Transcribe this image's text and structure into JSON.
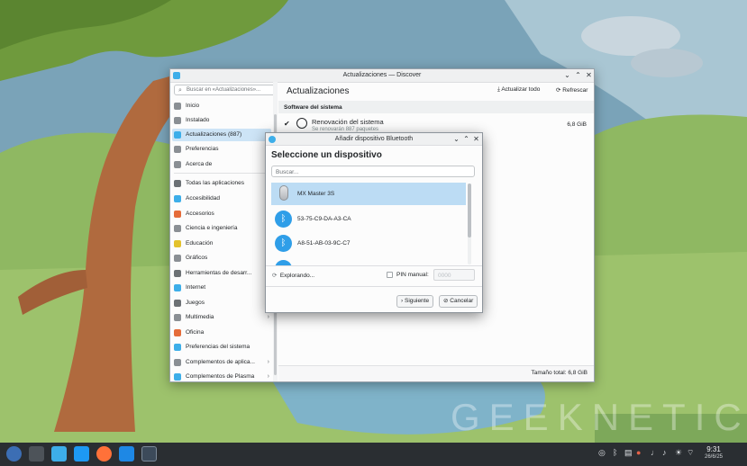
{
  "colors": {
    "accent": "#3daee9",
    "selection": "#cde4f6",
    "sky": "#7aa3b8",
    "grass": "#8fb862",
    "tree": "#b06a3e",
    "taskbar": "#2a2e32"
  },
  "discover": {
    "title": "Actualizaciones — Discover",
    "search_placeholder": "Buscar en «Actualizaciones»...",
    "page_title": "Actualizaciones",
    "update_all": "Actualizar todo",
    "refresh": "Refrescar",
    "nav": [
      {
        "label": "Inicio",
        "icon": "home-icon"
      },
      {
        "label": "Instalado",
        "icon": "installed-icon"
      },
      {
        "label": "Actualizaciones (887)",
        "icon": "updates-icon"
      },
      {
        "label": "Preferencias",
        "icon": "settings-icon"
      },
      {
        "label": "Acerca de",
        "icon": "info-icon"
      },
      {
        "label": "Todas las aplicaciones",
        "icon": "grid-icon"
      },
      {
        "label": "Accesibilidad",
        "icon": "accessibility-icon"
      },
      {
        "label": "Accesorios",
        "icon": "accessories-icon"
      },
      {
        "label": "Ciencia e ingeniería",
        "icon": "science-icon"
      },
      {
        "label": "Educación",
        "icon": "education-icon"
      },
      {
        "label": "Gráficos",
        "icon": "graphics-icon"
      },
      {
        "label": "Herramientas de desarr...",
        "icon": "dev-tools-icon"
      },
      {
        "label": "Internet",
        "icon": "internet-icon"
      },
      {
        "label": "Juegos",
        "icon": "games-icon"
      },
      {
        "label": "Multimedia",
        "icon": "multimedia-icon"
      },
      {
        "label": "Oficina",
        "icon": "office-icon"
      },
      {
        "label": "Preferencias del sistema",
        "icon": "system-settings-icon"
      },
      {
        "label": "Complementos de aplica...",
        "icon": "addons-icon"
      },
      {
        "label": "Complementos de Plasma",
        "icon": "plasma-addons-icon"
      }
    ],
    "section_header": "Software del sistema",
    "update_title": "Renovación del sistema",
    "update_subtitle": "Se renovarán 887 paquetes",
    "update_size": "6,8 GiB",
    "total_size": "Tamaño total: 6,8 GiB"
  },
  "dialog": {
    "title": "Añadir dispositivo Bluetooth",
    "heading": "Seleccione un dispositivo",
    "search_placeholder": "Buscar...",
    "devices": [
      {
        "name": "MX Master 3S",
        "icon": "mouse-icon"
      },
      {
        "name": "53-75-C9-DA-A3-CA",
        "icon": "bluetooth-icon"
      },
      {
        "name": "A8-51-AB-03-9C-C7",
        "icon": "bluetooth-icon"
      }
    ],
    "scanning": "Explorando...",
    "pin_label": "PIN manual:",
    "pin_placeholder": "0000",
    "next": "Siguiente",
    "cancel": "Cancelar"
  },
  "tray": {
    "time": "9:31",
    "date": "26/6/25"
  },
  "watermark": "GEEKNETIC"
}
